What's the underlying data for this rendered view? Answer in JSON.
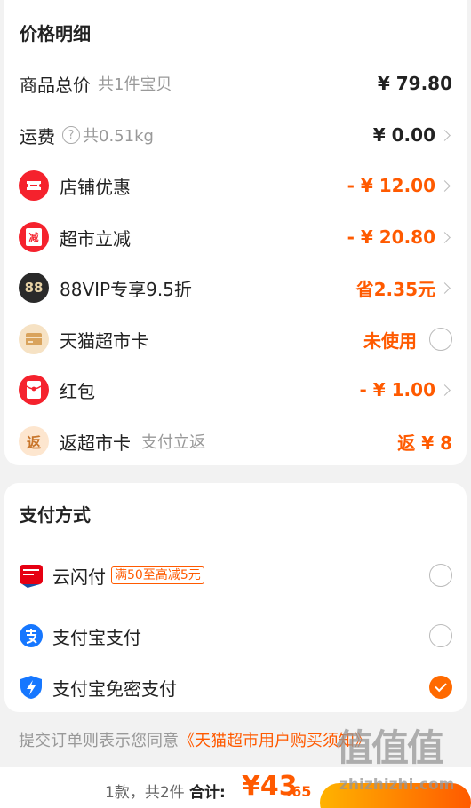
{
  "price_detail": {
    "title": "价格明细",
    "rows": [
      {
        "label": "商品总价",
        "sub": "共1件宝贝",
        "value": "¥ 79.80"
      },
      {
        "label": "运费",
        "sub": "共0.51kg",
        "value": "¥ 0.00"
      },
      {
        "label": "店铺优惠",
        "value": "- ¥ 12.00"
      },
      {
        "label": "超市立减",
        "value": "- ¥ 20.80"
      },
      {
        "label": "88VIP专享9.5折",
        "value": "省2.35元"
      },
      {
        "label": "天猫超市卡",
        "value": "未使用"
      },
      {
        "label": "红包",
        "value": "- ¥ 1.00"
      },
      {
        "label": "返超市卡",
        "sub": "支付立返",
        "value": "返 ¥ 8"
      }
    ],
    "icons": {
      "vip": "88",
      "cashback": "返",
      "coupon_char": "减"
    }
  },
  "payment": {
    "title": "支付方式",
    "methods": [
      {
        "label": "云闪付",
        "promo": "满50至高减5元",
        "selected": false
      },
      {
        "label": "支付宝支付",
        "selected": false
      },
      {
        "label": "支付宝免密支付",
        "selected": true
      }
    ]
  },
  "agreement": {
    "text": "提交订单则表示您同意",
    "link": "《天猫超市用户购买须知》"
  },
  "footer": {
    "summary": "1款，共2件",
    "total_label": "合计:",
    "total": "¥43",
    "cents": ".65"
  },
  "watermark": {
    "big": "值值值",
    "small": "zhizhizhi.com"
  },
  "colors": {
    "accent": "#ff5a00",
    "check": "#ff6a00",
    "background": "#f2f2f2"
  }
}
